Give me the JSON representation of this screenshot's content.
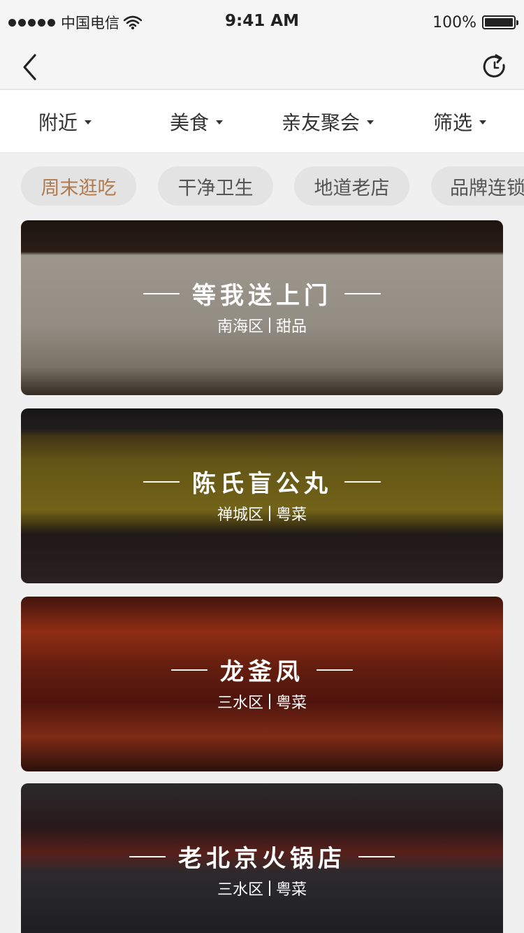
{
  "status_bar": {
    "carrier": "中国电信",
    "time": "9:41 AM",
    "battery": "100%",
    "battery_level": 1.0
  },
  "nav": {
    "back_icon": "chevron-left-icon",
    "refresh_icon": "refresh-icon"
  },
  "filters": [
    {
      "label": "附近"
    },
    {
      "label": "美食"
    },
    {
      "label": "亲友聚会"
    },
    {
      "label": "筛选"
    }
  ],
  "tags": [
    {
      "label": "周末逛吃",
      "active": true
    },
    {
      "label": "干净卫生",
      "active": false
    },
    {
      "label": "地道老店",
      "active": false
    },
    {
      "label": "品牌连锁",
      "active": false
    }
  ],
  "restaurants": [
    {
      "name": "等我送上门",
      "district": "南海区",
      "category": "甜品"
    },
    {
      "name": "陈氏盲公丸",
      "district": "禅城区",
      "category": "粤菜"
    },
    {
      "name": "龙釜凤",
      "district": "三水区",
      "category": "粤菜"
    },
    {
      "name": "老北京火锅店",
      "district": "三水区",
      "category": "粤菜"
    }
  ],
  "colors": {
    "accent_tag_text": "#b07a4e",
    "tag_bg": "#e3e3e3",
    "page_bg": "#f0f0f0"
  }
}
